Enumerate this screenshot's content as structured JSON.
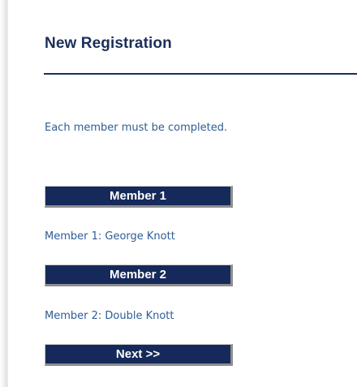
{
  "page": {
    "title": "New Registration",
    "note": "Each member must be completed."
  },
  "members": [
    {
      "button_label": "Member 1",
      "summary": "Member 1: George Knott"
    },
    {
      "button_label": "Member 2",
      "summary": "Member 2: Double Knott"
    }
  ],
  "actions": {
    "next_label": "Next >>"
  },
  "colors": {
    "title": "#1b2f5a",
    "text": "#2e5d95",
    "button_bg": "#15295a",
    "button_text": "#ffffff"
  }
}
